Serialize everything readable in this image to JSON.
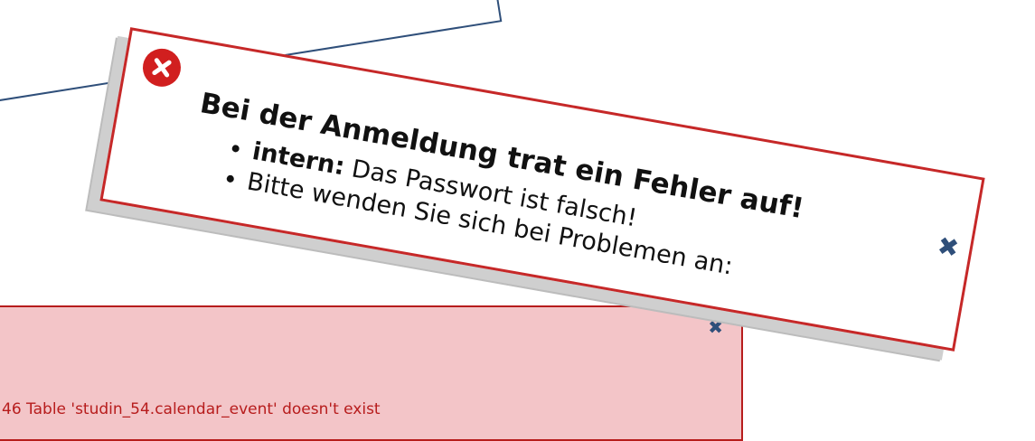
{
  "login_error": {
    "title": "Bei der Anmeldung trat ein Fehler auf!",
    "items": [
      {
        "label": "intern:",
        "text": " Das Passwort ist falsch!"
      },
      {
        "label": "",
        "text": "Bitte wenden Sie sich bei Problemen an:"
      }
    ],
    "close_symbol": "✖",
    "icon": "error-x-circle-icon",
    "border_color": "#c62828"
  },
  "db_error": {
    "message": "46 Table 'studin_54.calendar_event' doesn't exist",
    "close_symbol": "✖",
    "background_color": "#f3c5c8",
    "text_color": "#b71c1c"
  },
  "colors": {
    "close_icon": "#2f4f7a",
    "error_icon_bg": "#d11f1f"
  }
}
